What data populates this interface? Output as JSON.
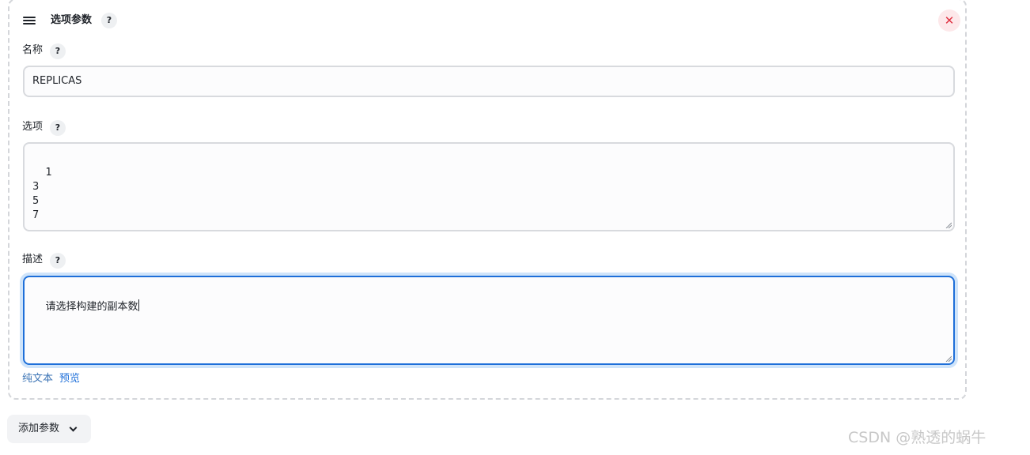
{
  "panel": {
    "title": "选项参数",
    "help_glyph": "?",
    "close_glyph": "✕"
  },
  "fields": {
    "name": {
      "label": "名称",
      "value": "REPLICAS"
    },
    "choices": {
      "label": "选项",
      "value": "1\n3\n5\n7"
    },
    "description": {
      "label": "描述",
      "value": "请选择构建的副本数"
    }
  },
  "description_links": {
    "plain_text": "纯文本",
    "preview": "预览"
  },
  "add_parameter_button": {
    "label": "添加参数"
  },
  "watermark": "CSDN @熟透的蜗牛",
  "colors": {
    "accent": "#1e6fd9",
    "close_red": "#e03444",
    "dashed_border": "#d4d6da"
  }
}
